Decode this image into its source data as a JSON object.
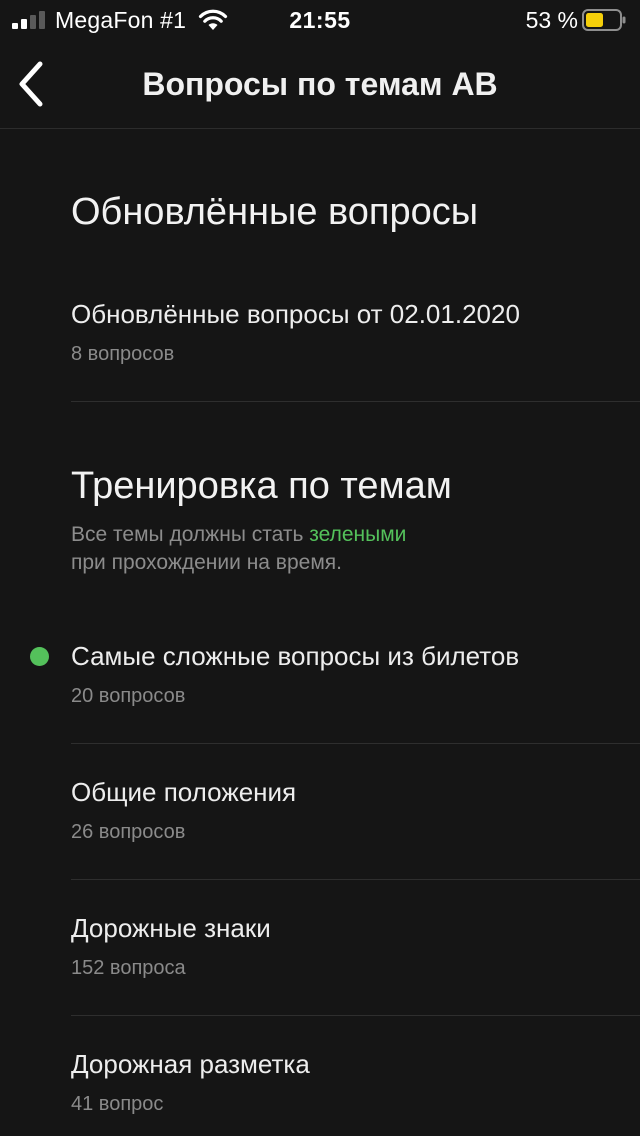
{
  "status_bar": {
    "carrier": "MegaFon #1",
    "time": "21:55",
    "battery_percent": "53 %",
    "battery_level": 0.53,
    "battery_color": "#f5cf0a"
  },
  "nav": {
    "title": "Вопросы по темам АВ",
    "back_icon": "chevron-left-icon"
  },
  "updated_section": {
    "title": "Обновлённые вопросы",
    "items": [
      {
        "title": "Обновлённые вопросы от 02.01.2020",
        "subtitle": "8 вопросов"
      }
    ]
  },
  "training_section": {
    "title": "Тренировка по темам",
    "desc_before": "Все темы должны стать ",
    "desc_green": "зелеными",
    "desc_after": "при прохождении на время.",
    "items": [
      {
        "title": "Самые сложные вопросы из билетов",
        "subtitle": "20 вопросов",
        "completed": true
      },
      {
        "title": "Общие положения",
        "subtitle": "26 вопросов",
        "completed": false
      },
      {
        "title": "Дорожные знаки",
        "subtitle": "152 вопроса",
        "completed": false
      },
      {
        "title": "Дорожная разметка",
        "subtitle": "41 вопрос",
        "completed": false
      }
    ]
  },
  "colors": {
    "background": "#151515",
    "accent_green": "#54c15b"
  }
}
